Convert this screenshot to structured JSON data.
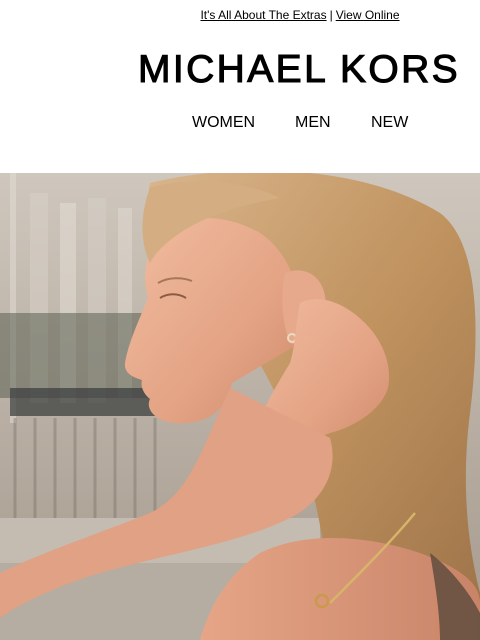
{
  "preheader": {
    "link_extras": "It's All About The Extras",
    "separator": "|",
    "link_view_online": "View Online"
  },
  "brand": {
    "logo_text": "MICHAEL KORS"
  },
  "nav": {
    "items": [
      {
        "label": "WOMEN"
      },
      {
        "label": "MEN"
      },
      {
        "label": "NEW"
      }
    ]
  },
  "hero": {
    "image": "hero-photo-woman-profile",
    "colors": {
      "skin": "#e8a88a",
      "hair": "#c59a6e",
      "background": "#b8aea2"
    }
  }
}
